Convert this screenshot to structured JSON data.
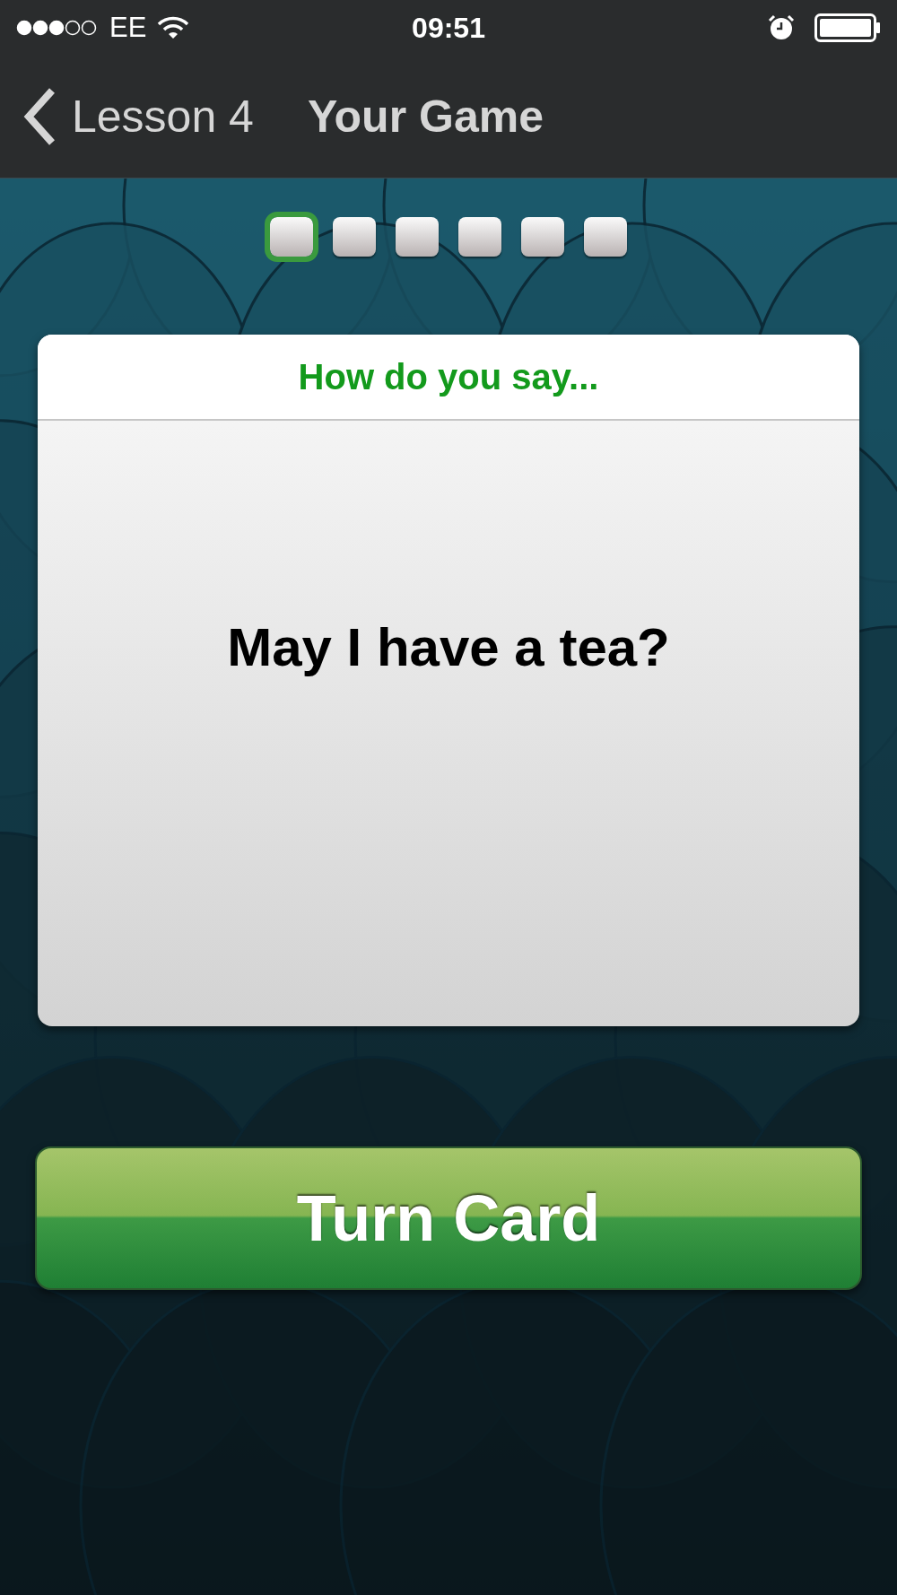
{
  "status_bar": {
    "carrier": "EE",
    "time": "09:51"
  },
  "nav_bar": {
    "back_label": "Lesson 4",
    "title": "Your Game"
  },
  "progress": [
    {
      "selected": true
    },
    {
      "selected": false
    },
    {
      "selected": false
    },
    {
      "selected": false
    },
    {
      "selected": false
    },
    {
      "selected": false
    }
  ],
  "card": {
    "header": "How do you say...",
    "prompt": "May I have a tea?"
  },
  "action_button": {
    "label": "Turn Card"
  }
}
